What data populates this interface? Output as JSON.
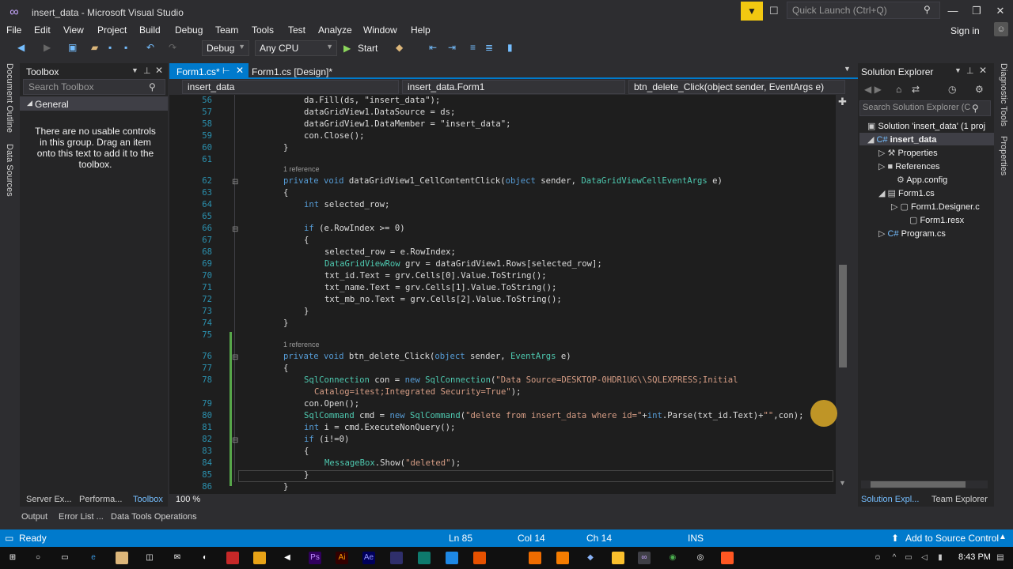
{
  "window": {
    "title": "insert_data - Microsoft Visual Studio",
    "quick_launch_placeholder": "Quick Launch (Ctrl+Q)",
    "sign_in": "Sign in"
  },
  "menu": [
    "File",
    "Edit",
    "View",
    "Project",
    "Build",
    "Debug",
    "Team",
    "Tools",
    "Test",
    "Analyze",
    "Window",
    "Help"
  ],
  "toolbar": {
    "config": "Debug",
    "platform": "Any CPU",
    "start": "Start"
  },
  "left_tabs": [
    "Document Outline",
    "Data Sources"
  ],
  "right_tabs": [
    "Diagnostic Tools",
    "Properties"
  ],
  "toolbox": {
    "title": "Toolbox",
    "search_placeholder": "Search Toolbox",
    "group": "General",
    "empty_message": "There are no usable controls in this group. Drag an item onto this text to add it to the toolbox."
  },
  "editor": {
    "tabs": [
      {
        "label": "Form1.cs*"
      },
      {
        "label": "Form1.cs [Design]*"
      }
    ],
    "nav": {
      "project": "insert_data",
      "class": "insert_data.Form1",
      "member": "btn_delete_Click(object sender, EventArgs e)"
    },
    "zoom": "100 %",
    "ref_label": "1 reference",
    "lines": {
      "l56": "da.Fill(ds, \"insert_data\");",
      "l57": "dataGridView1.DataSource = ds;",
      "l58": "dataGridView1.DataMember = \"insert_data\";",
      "l59": "con.Close();",
      "l60": "}",
      "l62a": "private void ",
      "l62b": "dataGridView1_CellContentClick(",
      "l62c": "object",
      "l62d": " sender, ",
      "l62e": "DataGridViewCellEventArgs",
      "l62f": " e)",
      "l63": "{",
      "l64a": "int",
      "l64b": " selected_row;",
      "l66a": "if",
      "l66b": " (e.RowIndex >= 0)",
      "l67": "{",
      "l68": "selected_row = e.RowIndex;",
      "l69a": "DataGridViewRow",
      "l69b": " grv = dataGridView1.Rows[selected_row];",
      "l70": "txt_id.Text = grv.Cells[0].Value.ToString();",
      "l71": "txt_name.Text = grv.Cells[1].Value.ToString();",
      "l72": "txt_mb_no.Text = grv.Cells[2].Value.ToString();",
      "l73": "}",
      "l74": "}",
      "l76a": "private void ",
      "l76b": "btn_delete_Click(",
      "l76c": "object",
      "l76d": " sender, ",
      "l76e": "EventArgs",
      "l76f": " e)",
      "l77": "{",
      "l78a": "SqlConnection",
      "l78b": " con = ",
      "l78c": "new ",
      "l78d": "SqlConnection",
      "l78e": "(",
      "l78f": "\"Data Source=DESKTOP-0HDR1UG\\\\SQLEXPRESS;Initial",
      "l78g": "Catalog=itest;Integrated Security=True\"",
      "l78h": ");",
      "l79": "con.Open();",
      "l80a": "SqlCommand",
      "l80b": " cmd = ",
      "l80c": "new ",
      "l80d": "SqlCommand",
      "l80e": "(",
      "l80f": "\"delete from insert_data where id=\"",
      "l80g": "+",
      "l80h": "int",
      "l80i": ".Parse(txt_id.Text)+",
      "l80j": "\"\"",
      "l80k": ",con);",
      "l81a": "int",
      "l81b": " i = cmd.ExecuteNonQuery();",
      "l82a": "if",
      "l82b": " (i!=0)",
      "l83": "{",
      "l84a": "MessageBox",
      "l84b": ".Show(",
      "l84c": "\"deleted\"",
      "l84d": ");",
      "l85": "}",
      "l86": "}"
    },
    "line_numbers": [
      "56",
      "57",
      "58",
      "59",
      "60",
      "61",
      "62",
      "63",
      "64",
      "65",
      "66",
      "67",
      "68",
      "69",
      "70",
      "71",
      "72",
      "73",
      "74",
      "75",
      "76",
      "77",
      "78",
      "79",
      "80",
      "81",
      "82",
      "83",
      "84",
      "85",
      "86"
    ]
  },
  "solution_explorer": {
    "title": "Solution Explorer",
    "search_placeholder": "Search Solution Explorer (C",
    "items": [
      "Solution 'insert_data' (1 proj",
      "insert_data",
      "Properties",
      "References",
      "App.config",
      "Form1.cs",
      "Form1.Designer.c",
      "Form1.resx",
      "Program.cs"
    ],
    "tabs": [
      "Solution Expl...",
      "Team Explorer"
    ]
  },
  "bottom_left_tabs": [
    "Server Ex...",
    "Performa...",
    "Toolbox"
  ],
  "bottom_tabs": [
    "Output",
    "Error List ...",
    "Data Tools Operations"
  ],
  "status": {
    "ready": "Ready",
    "ln": "Ln 85",
    "col": "Col 14",
    "ch": "Ch 14",
    "mode": "INS",
    "source_control": "Add to Source Control"
  },
  "taskbar": {
    "time": "8:43 PM"
  },
  "colors": {
    "accent": "#007acc",
    "keyword": "#569cd6",
    "type": "#4ec9b0",
    "string": "#d69d85",
    "linenum": "#2b91af"
  }
}
